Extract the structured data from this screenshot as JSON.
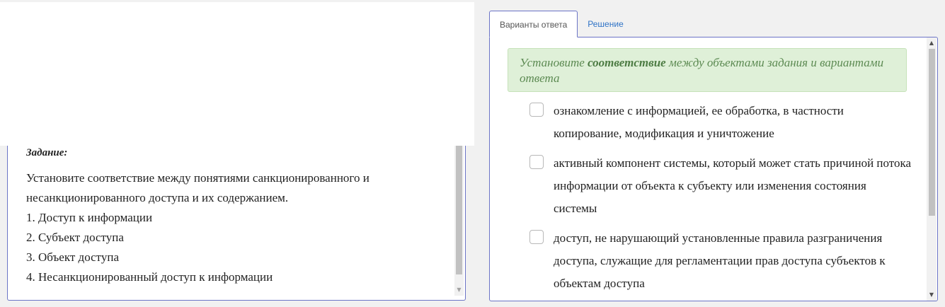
{
  "task": {
    "label": "Задание:",
    "lines": [
      "Установите соответствие между понятиями санкционированного и несанкционированного доступа и их содержанием.",
      "1. Доступ к информации",
      "2. Субъект доступа",
      "3. Объект доступа",
      "4. Несанкционированный доступ к информации"
    ]
  },
  "tabs": [
    {
      "label": "Варианты ответа",
      "active": true
    },
    {
      "label": "Решение",
      "active": false
    }
  ],
  "hint": {
    "prefix": "Установите ",
    "emphasis": "соответствие",
    "suffix": " между объектами задания и вариантами ответа"
  },
  "options": [
    {
      "text": "ознакомление с информацией, ее обработка, в частности копирование, модификация и уничтожение",
      "checked": false
    },
    {
      "text": "активный компонент системы, который может стать причиной потока информации от объекта к субъекту или изменения состояния системы",
      "checked": false
    },
    {
      "text": "доступ, не нарушающий установленные правила разграничения доступа, служащие для регламентации прав доступа субъектов к объектам доступа",
      "checked": false
    }
  ],
  "colors": {
    "panel_border": "#6b74c6",
    "hint_bg": "#dff0d8",
    "hint_text": "#5c8a52",
    "link": "#2f73c6"
  },
  "icons": {
    "scroll_up": "▲",
    "scroll_down": "▼"
  }
}
